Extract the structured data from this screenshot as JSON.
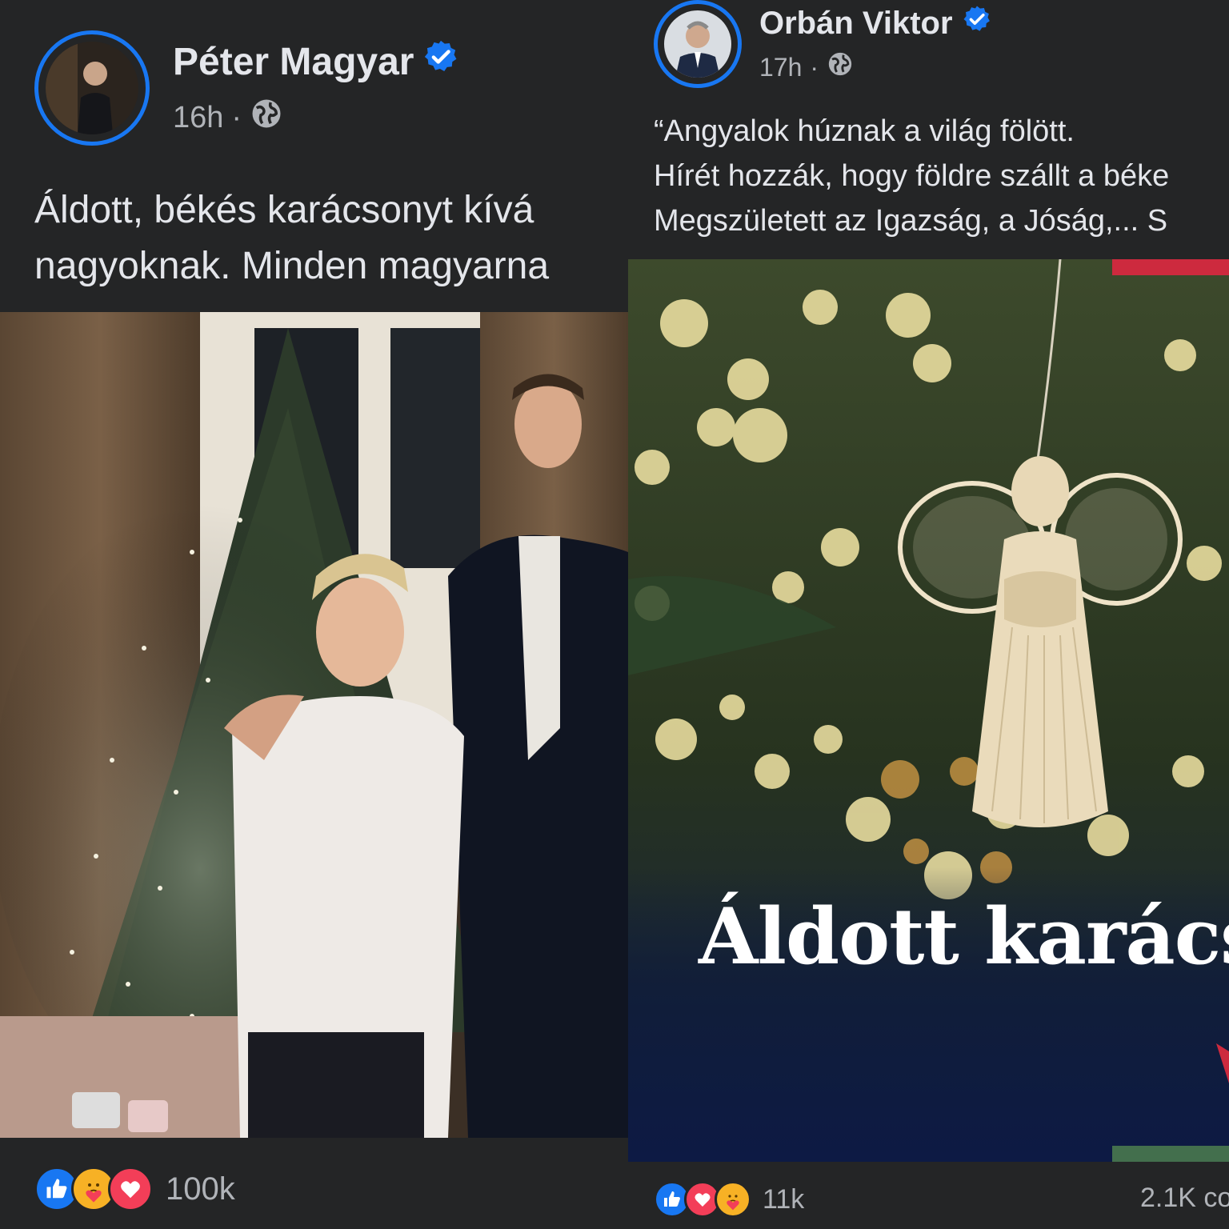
{
  "left_post": {
    "author": "Péter Magyar",
    "time": "16h",
    "separator": "·",
    "text_lines": [
      "Áldott, békés karácsonyt kívá",
      "nagyoknak. Minden magyarna"
    ],
    "reaction_count": "100k",
    "reactions": [
      "like-icon",
      "care-icon",
      "love-icon"
    ]
  },
  "right_post": {
    "author": "Orbán Viktor",
    "time": "17h",
    "separator": "·",
    "text_lines": [
      "“Angyalok húznak a világ fölött.",
      "Hírét hozzák, hogy földre szállt a béke",
      "Megszületett az Igazság, a Jóság,... S"
    ],
    "image_caption": "Áldott karács",
    "reaction_count": "11k",
    "comments": "2.1K co",
    "reactions": [
      "like-icon",
      "love-icon",
      "care-icon"
    ]
  },
  "colors": {
    "background": "#242526",
    "verified": "#1877f2",
    "text": "#e4e6eb",
    "secondary_text": "#b0b3b8",
    "flag_red": "#cd2a3e",
    "flag_green": "#436f4d"
  }
}
